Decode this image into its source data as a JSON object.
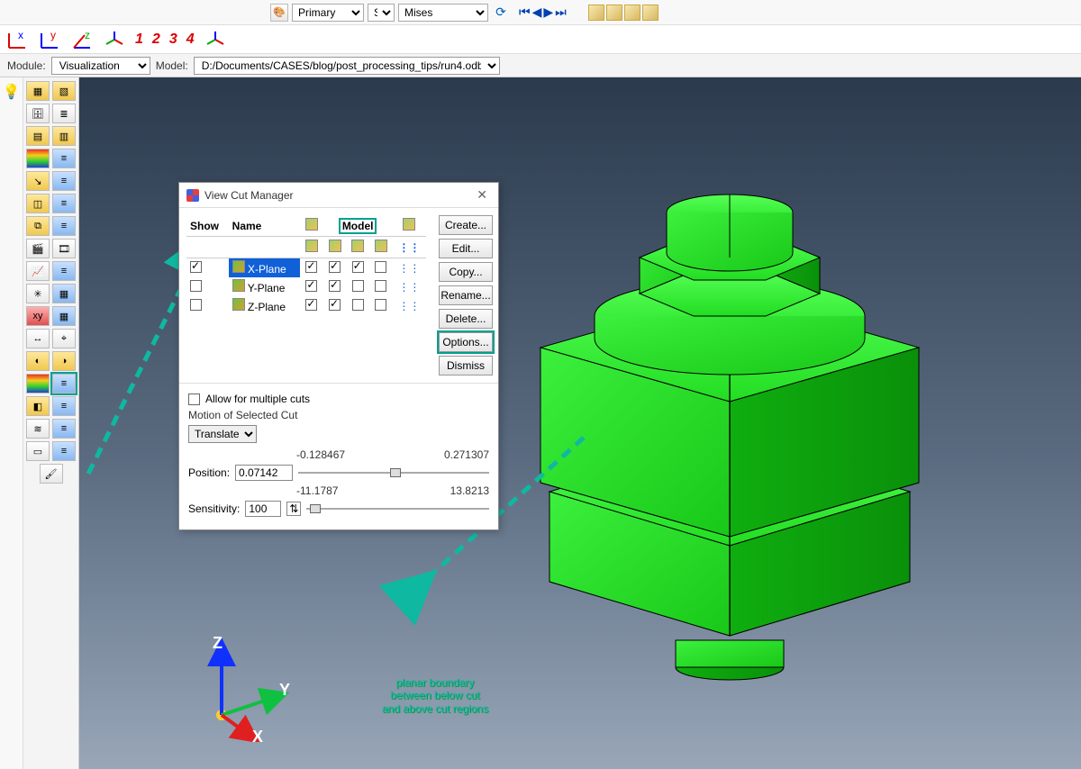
{
  "toolbar": {
    "palette_icon": "palette",
    "primary_selector": "Primary",
    "var_selector": "S",
    "component_selector": "Mises",
    "vcr": {
      "first": "⏮",
      "prev": "◀",
      "play": "▶",
      "last": "⏭"
    }
  },
  "axis_numbers": [
    "1",
    "2",
    "3",
    "4"
  ],
  "context": {
    "module_label": "Module:",
    "module_value": "Visualization",
    "model_label": "Model:",
    "model_path": "D:/Documents/CASES/blog/post_processing_tips/run4.odb"
  },
  "dialog": {
    "title": "View Cut Manager",
    "headers": {
      "show": "Show",
      "name": "Name",
      "model": "Model"
    },
    "rows": [
      {
        "show": true,
        "name": "X-Plane",
        "c1": true,
        "c2": true,
        "c3": true,
        "c4": false,
        "selected": true
      },
      {
        "show": false,
        "name": "Y-Plane",
        "c1": true,
        "c2": true,
        "c3": false,
        "c4": false,
        "selected": false
      },
      {
        "show": false,
        "name": "Z-Plane",
        "c1": true,
        "c2": true,
        "c3": false,
        "c4": false,
        "selected": false
      }
    ],
    "buttons": {
      "create": "Create...",
      "edit": "Edit...",
      "copy": "Copy...",
      "rename": "Rename...",
      "delete": "Delete...",
      "options": "Options...",
      "dismiss": "Dismiss"
    },
    "allow_multiple_label": "Allow for multiple cuts",
    "allow_multiple": false,
    "motion_label": "Motion of Selected Cut",
    "motion_value": "Translate",
    "position_label": "Position:",
    "position_value": "0.07142",
    "position_min": "-0.128467",
    "position_max": "0.271307",
    "sensitivity_label": "Sensitivity:",
    "sensitivity_value": "100",
    "sensitivity_min": "-11.1787",
    "sensitivity_max": "13.8213"
  },
  "triad": {
    "x": "X",
    "y": "Y",
    "z": "Z"
  },
  "annotation": {
    "line1": "planar boundary",
    "line2": "between below cut",
    "line3": "and above cut regions"
  }
}
